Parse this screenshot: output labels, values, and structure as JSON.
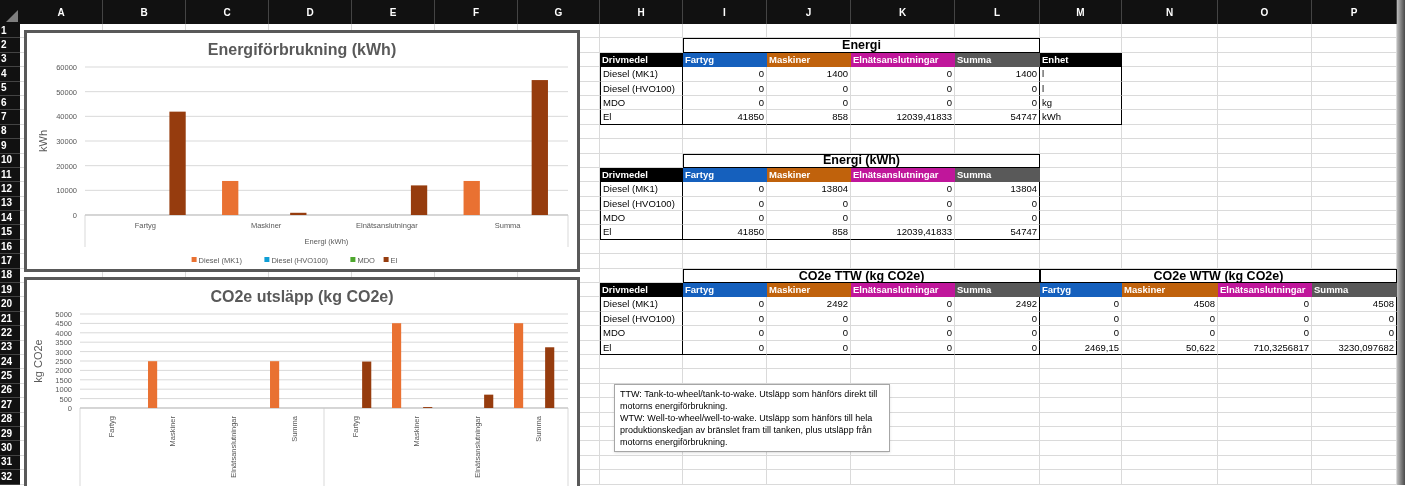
{
  "sheet": {
    "column_headers": [
      "A",
      "B",
      "C",
      "D",
      "E",
      "F",
      "G",
      "H",
      "I",
      "J",
      "K",
      "L",
      "M",
      "N",
      "O",
      "P"
    ],
    "row_headers": [
      "1",
      "2",
      "3",
      "4",
      "5",
      "6",
      "7",
      "8",
      "9",
      "10",
      "11",
      "12",
      "13",
      "14",
      "15",
      "16",
      "17",
      "18",
      "19",
      "20",
      "21",
      "22",
      "23",
      "24",
      "25",
      "26",
      "27",
      "28",
      "29",
      "30",
      "31",
      "32"
    ]
  },
  "charts": [
    {
      "chart_data": {
        "type": "bar",
        "title": "Energiförbrukning (kWh)",
        "xlabel": "Energi (kWh)",
        "ylabel": "kWh",
        "categories": [
          "Fartyg",
          "Maskiner",
          "Elnätsanslutningar",
          "Summa"
        ],
        "series": [
          {
            "name": "Diesel (MK1)",
            "color": "#e97132",
            "values": [
              0,
              13800,
              0,
              13800
            ]
          },
          {
            "name": "Diesel (HVO100)",
            "color": "#0f9ed5",
            "values": [
              0,
              0,
              0,
              0
            ]
          },
          {
            "name": "MDO",
            "color": "#4ea72e",
            "values": [
              0,
              0,
              0,
              0
            ]
          },
          {
            "name": "El",
            "color": "#963c0e",
            "values": [
              41900,
              900,
              12000,
              54700
            ]
          }
        ],
        "grid": true,
        "legend": true,
        "ylim": [
          0,
          60000
        ],
        "yticks": [
          0,
          10000,
          20000,
          30000,
          40000,
          50000,
          60000
        ]
      }
    },
    {
      "chart_data": {
        "type": "bar",
        "title": "CO2e utsläpp (kg CO2e)",
        "ylabel": "kg CO2e",
        "categories": [
          "Fartyg",
          "Maskiner",
          "Elnätsanslutningar",
          "Summa",
          "Fartyg",
          "Maskiner",
          "Elnätsanslutningar",
          "Summa"
        ],
        "series": [
          {
            "color": "#e97132",
            "values": [
              0,
              2490,
              0,
              2490,
              0,
              4510,
              0,
              4510
            ]
          },
          {
            "values": [
              0,
              0,
              0,
              0,
              0,
              0,
              0,
              0
            ]
          },
          {
            "values": [
              0,
              0,
              0,
              0,
              0,
              0,
              0,
              0
            ]
          },
          {
            "color": "#963c0e",
            "values": [
              0,
              0,
              0,
              0,
              2470,
              50,
              710,
              3230
            ]
          }
        ],
        "grid": true,
        "ylim": [
          0,
          5000
        ],
        "yticks": [
          0,
          500,
          1000,
          1500,
          2000,
          2500,
          3000,
          3500,
          4000,
          4500,
          5000
        ]
      }
    }
  ],
  "tables": [
    {
      "groups": [
        {
          "title": "Energi"
        }
      ],
      "columns": [
        {
          "label": "Drivmedel",
          "kind": "text",
          "color": "#000000"
        },
        {
          "label": "Fartyg",
          "kind": "number",
          "color": "#1560bd"
        },
        {
          "label": "Maskiner",
          "kind": "number",
          "color": "#c0620c"
        },
        {
          "label": "Elnätsanslutningar",
          "kind": "number",
          "color": "#c0169b"
        },
        {
          "label": "Summa",
          "kind": "number",
          "color": "#595959"
        },
        {
          "label": "Enhet",
          "kind": "text",
          "color": "#000000"
        }
      ],
      "rows": [
        [
          "Diesel (MK1)",
          "0",
          "1400",
          "0",
          "1400",
          "l"
        ],
        [
          "Diesel (HVO100)",
          "0",
          "0",
          "0",
          "0",
          "l"
        ],
        [
          "MDO",
          "0",
          "0",
          "0",
          "0",
          "kg"
        ],
        [
          "El",
          "41850",
          "858",
          "12039,41833",
          "54747",
          "kWh"
        ]
      ]
    },
    {
      "groups": [
        {
          "title": "Energi (kWh)"
        }
      ],
      "columns": [
        {
          "label": "Drivmedel",
          "kind": "text",
          "color": "#000000"
        },
        {
          "label": "Fartyg",
          "kind": "number",
          "color": "#1560bd"
        },
        {
          "label": "Maskiner",
          "kind": "number",
          "color": "#c0620c"
        },
        {
          "label": "Elnätsanslutningar",
          "kind": "number",
          "color": "#c0169b"
        },
        {
          "label": "Summa",
          "kind": "number",
          "color": "#595959"
        }
      ],
      "rows": [
        [
          "Diesel (MK1)",
          "0",
          "13804",
          "0",
          "13804"
        ],
        [
          "Diesel (HVO100)",
          "0",
          "0",
          "0",
          "0"
        ],
        [
          "MDO",
          "0",
          "0",
          "0",
          "0"
        ],
        [
          "El",
          "41850",
          "858",
          "12039,41833",
          "54747"
        ]
      ]
    },
    {
      "groups": [
        {
          "title": "CO2e TTW (kg CO2e)"
        },
        {
          "title": "CO2e WTW (kg CO2e)"
        }
      ],
      "columns": [
        {
          "label": "Drivmedel",
          "kind": "text",
          "color": "#000000"
        },
        {
          "label": "Fartyg",
          "kind": "number",
          "color": "#1560bd"
        },
        {
          "label": "Maskiner",
          "kind": "number",
          "color": "#c0620c"
        },
        {
          "label": "Elnätsanslutningar",
          "kind": "number",
          "color": "#c0169b"
        },
        {
          "label": "Summa",
          "kind": "number",
          "color": "#595959"
        },
        {
          "label": "Fartyg",
          "kind": "number",
          "color": "#1560bd"
        },
        {
          "label": "Maskiner",
          "kind": "number",
          "color": "#c0620c"
        },
        {
          "label": "Elnätsanslutningar",
          "kind": "number",
          "color": "#c0169b"
        },
        {
          "label": "Summa",
          "kind": "number",
          "color": "#595959"
        }
      ],
      "rows": [
        [
          "Diesel (MK1)",
          "0",
          "2492",
          "0",
          "2492",
          "0",
          "4508",
          "0",
          "4508"
        ],
        [
          "Diesel (HVO100)",
          "0",
          "0",
          "0",
          "0",
          "0",
          "0",
          "0",
          "0"
        ],
        [
          "MDO",
          "0",
          "0",
          "0",
          "0",
          "0",
          "0",
          "0",
          "0"
        ],
        [
          "El",
          "0",
          "0",
          "0",
          "0",
          "2469,15",
          "50,622",
          "710,3256817",
          "3230,097682"
        ]
      ]
    }
  ],
  "note": {
    "paragraphs": [
      "TTW: Tank-to-wheel/tank-to-wake. Utsläpp som hänförs direkt till motorns energiförbrukning.",
      "WTW: Well-to-wheel/well-to-wake. Utsläpp som hänförs till hela produktionskedjan av bränslet fram till tanken, plus utsläpp från motorns energiförbrukning."
    ]
  }
}
